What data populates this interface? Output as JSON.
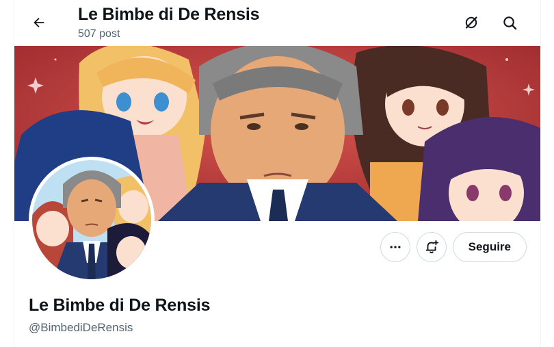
{
  "header": {
    "title": "Le Bimbe di De Rensis",
    "post_count": "507 post",
    "back_icon": "arrow-left-icon",
    "action_icons": [
      "grok-icon",
      "search-icon"
    ]
  },
  "banner": {
    "description_icon": "profile-banner-image"
  },
  "profile": {
    "name": "Le Bimbe di De Rensis",
    "handle": "@BimbediDeRensis"
  },
  "actions": {
    "more_icon": "more-icon",
    "notify_icon": "bell-plus-icon",
    "follow_label": "Seguire"
  },
  "colors": {
    "text_primary": "#0f1419",
    "text_secondary": "#536471",
    "border": "#cfd9de",
    "banner_bg": "#b6383a"
  }
}
